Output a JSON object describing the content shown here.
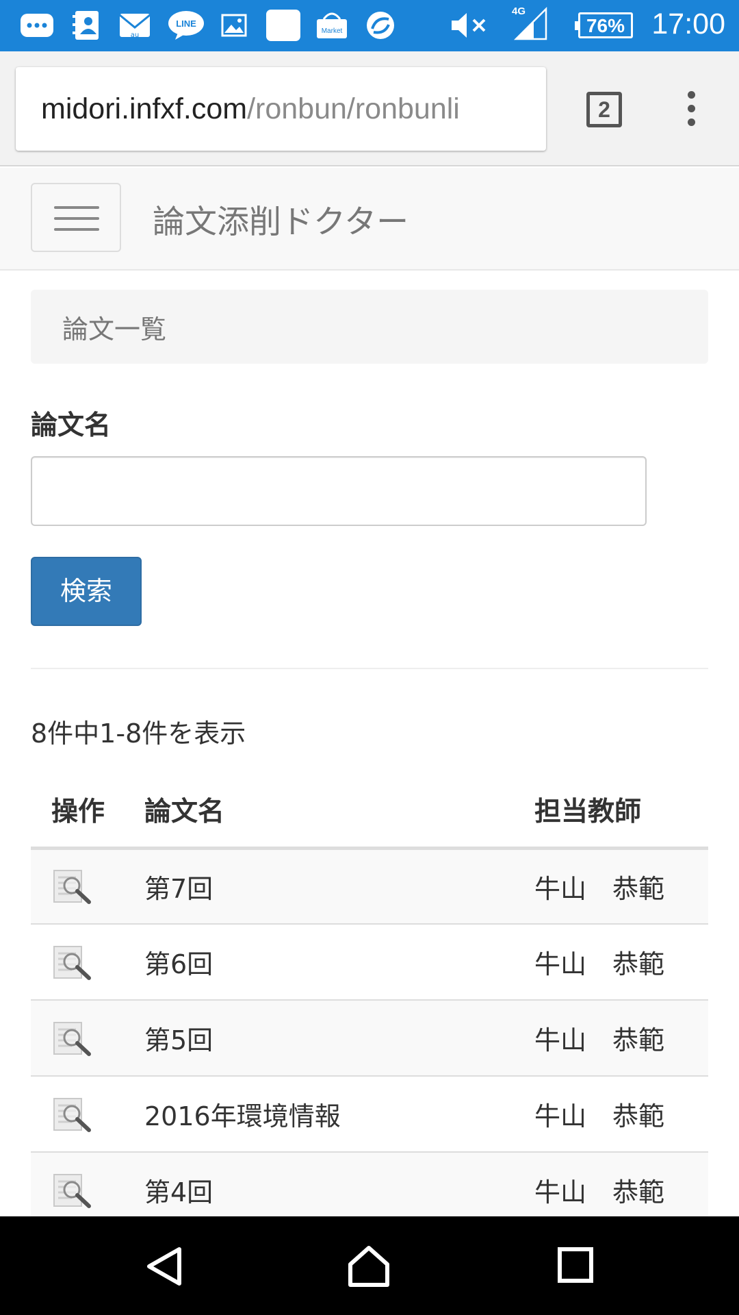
{
  "status_bar": {
    "time": "17:00",
    "battery": "76%",
    "network": "4G",
    "icons": [
      "chat-icon",
      "contacts-icon",
      "au-mail-icon",
      "line-icon",
      "gallery-icon",
      "app-icon",
      "market-icon",
      "sync-icon",
      "mute-icon",
      "signal-icon",
      "battery-icon"
    ],
    "labels": {
      "line": "LINE",
      "market": "Market",
      "mail": "au"
    }
  },
  "browser": {
    "url_host": "midori.infxf.com",
    "url_path": "/ronbun/ronbunli",
    "tab_count": "2"
  },
  "navbar": {
    "brand": "論文添削ドクター"
  },
  "breadcrumb": {
    "current": "論文一覧"
  },
  "search_form": {
    "label": "論文名",
    "input_value": "",
    "button_label": "検索"
  },
  "results": {
    "summary": "8件中1-8件を表示",
    "columns": [
      "操作",
      "論文名",
      "担当教師"
    ],
    "rows": [
      {
        "title": "第7回",
        "teacher": "牛山　恭範",
        "action_icon": "view-icon"
      },
      {
        "title": "第6回",
        "teacher": "牛山　恭範",
        "action_icon": "view-icon"
      },
      {
        "title": "第5回",
        "teacher": "牛山　恭範",
        "action_icon": "view-icon"
      },
      {
        "title": "2016年環境情報",
        "teacher": "牛山　恭範",
        "action_icon": "view-icon"
      },
      {
        "title": "第4回",
        "teacher": "牛山　恭範",
        "action_icon": "view-icon"
      }
    ]
  },
  "colors": {
    "status_bar": "#1b84d8",
    "primary_button": "#337ab7",
    "navbar_bg": "#f8f8f8",
    "android_nav": "#000000"
  }
}
